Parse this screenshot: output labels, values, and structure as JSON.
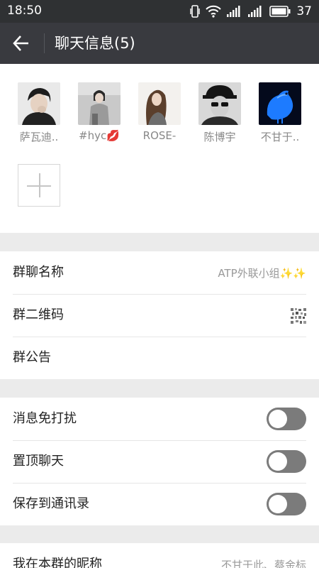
{
  "status": {
    "time": "18:50",
    "battery": "37"
  },
  "header": {
    "title": "聊天信息(5)"
  },
  "members": [
    {
      "name": "萨瓦迪.."
    },
    {
      "name": "#hyc💋"
    },
    {
      "name": "ROSE-"
    },
    {
      "name": "陈博宇"
    },
    {
      "name": "不甘于.."
    }
  ],
  "group_info": {
    "name_label": "群聊名称",
    "name_value": "ATP外联小组✨✨",
    "qrcode_label": "群二维码",
    "notice_label": "群公告"
  },
  "settings": {
    "mute_label": "消息免打扰",
    "mute_on": false,
    "pin_label": "置顶聊天",
    "pin_on": false,
    "save_label": "保存到通讯录",
    "save_on": false
  },
  "nickname": {
    "label": "我在本群的昵称",
    "value": "不甘于此、蔡金标"
  },
  "colors": {
    "statusbar": "#2f3133",
    "appbar": "#393a3f",
    "toggle_off": "#7b7b7b"
  }
}
